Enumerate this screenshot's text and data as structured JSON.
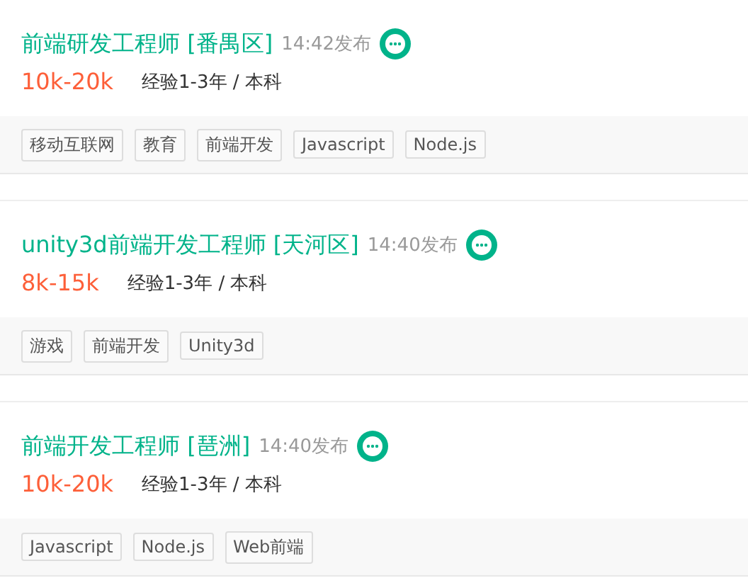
{
  "jobs": [
    {
      "title": "前端研发工程师 [番禺区]",
      "time": "14:42发布",
      "salary": "10k-20k",
      "requirement": "经验1-3年 / 本科",
      "tags": [
        "移动互联网",
        "教育",
        "前端开发",
        "Javascript",
        "Node.js"
      ]
    },
    {
      "title": "unity3d前端开发工程师 [天河区]",
      "time": "14:40发布",
      "salary": "8k-15k",
      "requirement": "经验1-3年 / 本科",
      "tags": [
        "游戏",
        "前端开发",
        "Unity3d"
      ]
    },
    {
      "title": "前端开发工程师 [琶洲]",
      "time": "14:40发布",
      "salary": "10k-20k",
      "requirement": "经验1-3年 / 本科",
      "tags": [
        "Javascript",
        "Node.js",
        "Web前端"
      ]
    }
  ]
}
